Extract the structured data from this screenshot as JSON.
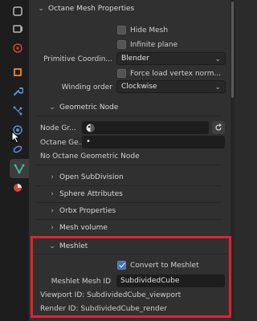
{
  "tabs": [
    {
      "name": "tool-icon",
      "color": "#b8b8b8"
    },
    {
      "name": "render-icon",
      "color": "#b8b8b8"
    },
    {
      "name": "scene-icon",
      "color": "#b8b8b8"
    },
    {
      "name": "world-icon",
      "color": "#d0473a"
    },
    {
      "name": "object-icon",
      "color": "#e88d2e"
    },
    {
      "name": "modifier-icon",
      "color": "#5d8fd6"
    },
    {
      "name": "particles-icon",
      "color": "#5d8fd6"
    },
    {
      "name": "physics-icon",
      "color": "#5d8fd6"
    },
    {
      "name": "constraints-icon",
      "color": "#5d8fd6"
    },
    {
      "name": "data-icon",
      "color": "#3fbf9f"
    },
    {
      "name": "material-icon",
      "color": "#d0473a"
    }
  ],
  "octane_mesh": {
    "header": "Octane Mesh Properties",
    "hide_mesh": "Hide Mesh",
    "infinite_plane": "Infinite plane",
    "primitive_label": "Primitive Coordin...",
    "primitive_value": "Blender",
    "force_load": "Force load vertex norm...",
    "winding_label": "Winding order",
    "winding_value": "Clockwise"
  },
  "geometric_node": {
    "header": "Geometric Node",
    "node_graph_label": "Node Gr...",
    "octane_geo_label": "Octane Ge...",
    "status": "No Octane Geometric Node"
  },
  "subpanels": [
    "Open SubDivision",
    "Sphere Attributes",
    "Orbx Properties",
    "Mesh volume"
  ],
  "meshlet": {
    "header": "Meshlet",
    "convert": "Convert to Meshlet",
    "mesh_id_label": "Meshlet Mesh ID",
    "mesh_id_value": "SubdividedCube",
    "viewport_id": "Viewport ID: SubdividedCube_viewport",
    "render_id": "Render ID: SubdividedCube_render"
  },
  "colors": {
    "highlight": "#e0242e",
    "checkbox_accent": "#4772b3"
  }
}
